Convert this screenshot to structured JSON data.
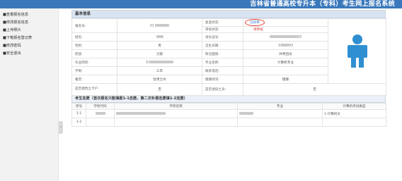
{
  "header": {
    "title": "吉林省普通高校专升本（专科）考生网上报名系统"
  },
  "sidebar": {
    "items": [
      {
        "label": "■查看报名信息",
        "icon": "info-icon"
      },
      {
        "label": "■修改报名信息",
        "icon": "edit-icon"
      },
      {
        "label": "■上传照片",
        "icon": "upload-icon"
      },
      {
        "label": "■下载报名登记表",
        "icon": "download-icon"
      },
      {
        "label": "■修改密码",
        "icon": "key-icon"
      },
      {
        "label": "■安全退出",
        "icon": "logout-icon"
      }
    ]
  },
  "basic": {
    "section_title": "基本信息",
    "reg_no_label": "报名号:",
    "reg_no_value": "21",
    "review_status_label": "复查状态:",
    "review_status_value": "已初审",
    "audit_status_label": "审核状态:",
    "audit_status_value": "待审核",
    "name_label": "姓名:",
    "id_label": "身份证号:",
    "id_value_suffix": "31",
    "gender_label": "性别:",
    "gender_value": "男",
    "birth_label": "出生日期:",
    "birth_value_prefix": "1",
    "birth_value_suffix": "03",
    "ethnicity_label": "民族:",
    "ethnicity_value": "汉族",
    "political_label": "政治面貌:",
    "political_value": "共青团员",
    "school_label": "毕业院校:",
    "school_value_prefix": "1(",
    "major_label": "专业名称:",
    "major_value": "计算机专业",
    "duration_label": "学制:",
    "duration_value": "三年",
    "phone_label": "联系电话:",
    "hukou_label": "籍贯:",
    "hukou_value": "甘肃兰州",
    "health_label": "健康状况:",
    "health_value": "健康",
    "poverty_label": "是否建档立卡户:",
    "poverty_value": "否",
    "retired_label": "是否退役士兵:",
    "retired_value": "否"
  },
  "choices": {
    "section_title": "考生志愿（首次报名只能填报1-1志愿，第二次补报志愿填1-2志愿）",
    "headers": [
      "序号",
      "学校代码",
      "学校名称",
      "专业",
      "计算机考试类型"
    ],
    "rows": [
      {
        "seq": "1-1",
        "type": "1-计算机文"
      },
      {
        "seq": "1-2",
        "type": ""
      }
    ]
  },
  "colors": {
    "topbar": "#3a78bb",
    "accent_red": "#d9332e",
    "photo_blue": "#2f8fd0"
  }
}
